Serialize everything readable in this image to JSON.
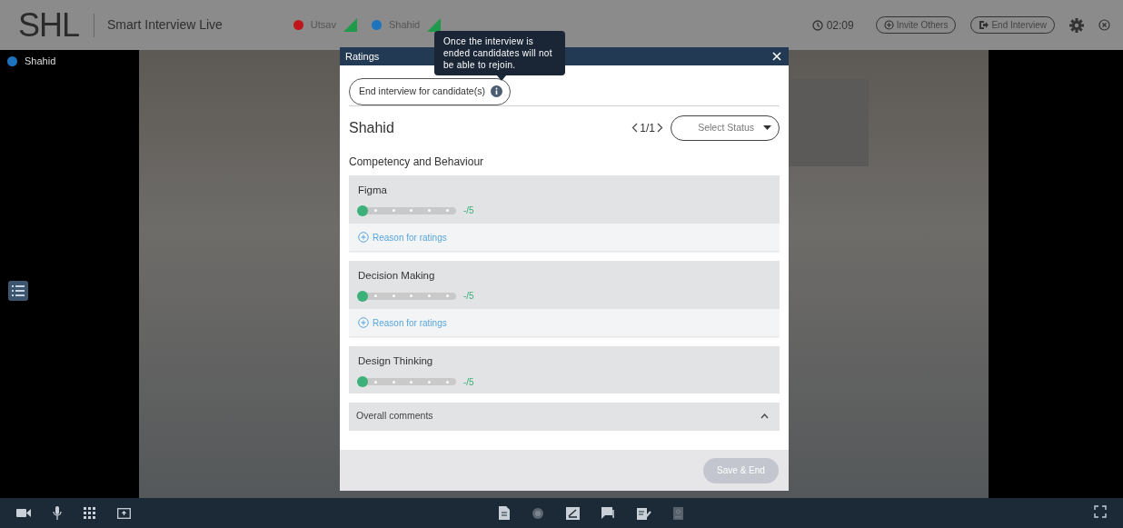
{
  "app": {
    "logo": "SHL",
    "title": "Smart Interview Live"
  },
  "participants": [
    {
      "name": "Utsav",
      "color": "#c0161b"
    },
    {
      "name": "Shahid",
      "color": "#1e73be"
    }
  ],
  "timer": "02:09",
  "header_buttons": [
    {
      "label": "Invite Others",
      "kind": "invite"
    },
    {
      "label": "End Interview",
      "kind": "end"
    }
  ],
  "video": {
    "tile_label": "Shahid",
    "color": "#1e73be"
  },
  "modal": {
    "title": "Ratings",
    "end_button": "End interview for candidate(s)",
    "tooltip": "Once the interview is ended candidates will not be able to rejoin.",
    "candidate": "Shahid",
    "pager": "1/1",
    "status_placeholder": "Select Status",
    "section": "Competency and Behaviour",
    "competencies": [
      {
        "name": "Figma",
        "level": 0,
        "score": "-/5",
        "reason": "Reason for ratings"
      },
      {
        "name": "Decision Making",
        "level": 0,
        "score": "-/5",
        "reason": "Reason for ratings"
      },
      {
        "name": "Design Thinking",
        "level": 0,
        "score": "-/5"
      }
    ],
    "overall_comments": {
      "label": "Overall comments",
      "expanded": false
    },
    "save_button": {
      "label": "Save & End",
      "disabled": true
    }
  }
}
